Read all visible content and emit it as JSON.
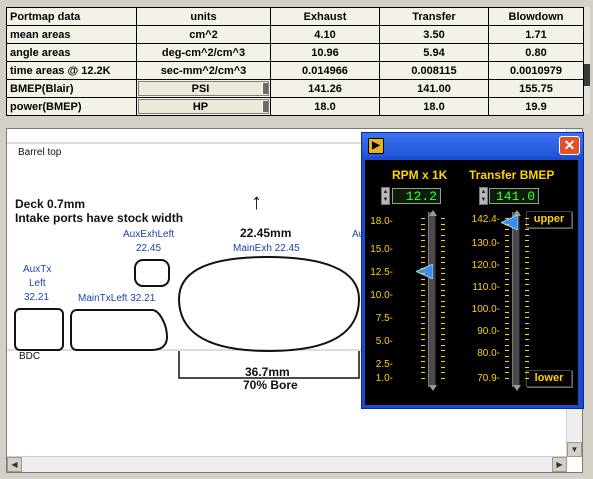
{
  "table": {
    "header": [
      "Portmap data",
      "units",
      "Exhaust",
      "Transfer",
      "Blowdown"
    ],
    "rows": [
      {
        "label": "mean areas",
        "units": "cm^2",
        "exhaust": "4.10",
        "transfer": "3.50",
        "blowdown": "1.71"
      },
      {
        "label": "angle areas",
        "units": "deg-cm^2/cm^3",
        "exhaust": "10.96",
        "transfer": "5.94",
        "blowdown": "0.80"
      },
      {
        "label": "time areas @ 12.2K",
        "units": "sec-mm^2/cm^3",
        "exhaust": "0.014966",
        "transfer": "0.008115",
        "blowdown": "0.0010979"
      },
      {
        "label": "BMEP(Blair)",
        "units": "PSI",
        "exhaust": "141.26",
        "transfer": "141.00",
        "blowdown": "155.75"
      },
      {
        "label": "power(BMEP)",
        "units": "HP",
        "exhaust": "18.0",
        "transfer": "18.0",
        "blowdown": "19.9"
      }
    ]
  },
  "drawing": {
    "barrel_top": "Barrel top",
    "bdc": "BDC",
    "deck": "Deck 0.7mm",
    "intake_note": "Intake ports have stock width",
    "arrow": "↑",
    "main_exh_dim": "22.45mm",
    "main_exh_label": "MainExh 22.45",
    "aux_exh_left_name": "AuxExhLeft",
    "aux_exh_left_val": "22.45",
    "aux_cut": "Au",
    "aux_tx_1": "AuxTx",
    "aux_tx_2": "Left",
    "aux_tx_3": "32.21",
    "main_tx_left": "MainTxLeft 32.21",
    "bore_dim": "36.7mm",
    "bore_pct": "70% Bore"
  },
  "window": {
    "close": "✕",
    "rpm_header": "RPM x 1K",
    "rpm_value": "12.2",
    "rpm_ticks": [
      "18.0-",
      "15.0-",
      "12.5-",
      "10.0-",
      "7.5-",
      "5.0-",
      "2.5-",
      "1.0-"
    ],
    "tx_header": "Transfer BMEP",
    "tx_value": "141.0",
    "tx_ticks": [
      "142.4-",
      "130.0-",
      "120.0-",
      "110.0-",
      "100.0-",
      "90.0-",
      "80.0-",
      "70.9-"
    ],
    "upper": "upper",
    "lower": "lower"
  },
  "colors": {
    "panel_text": "#ffd200",
    "digital": "#3cff3c",
    "titlebar": "#1d56d6",
    "pointer": "#3a8ee8"
  }
}
